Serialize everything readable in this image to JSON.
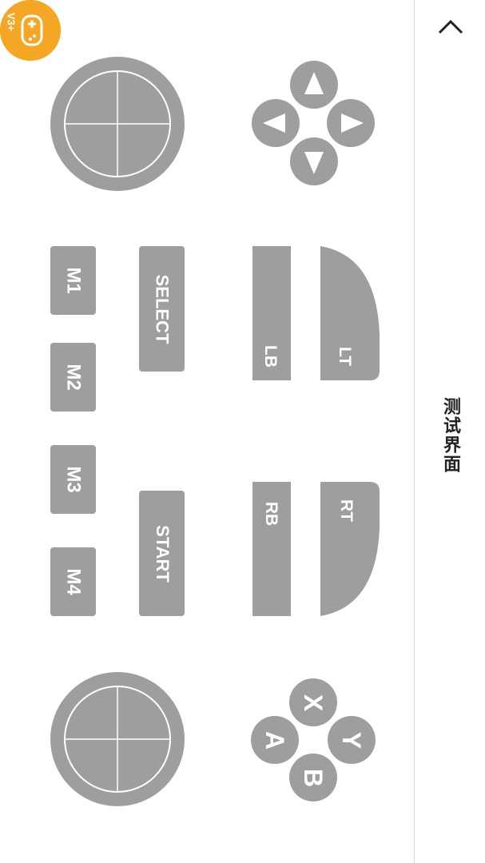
{
  "header": {
    "title": "测试界面",
    "collapse_icon": "chevron-up-icon"
  },
  "logo": {
    "text": "V3+",
    "icon": "gamepad-icon",
    "color": "#f5a623"
  },
  "colors": {
    "button": "#9e9e9e",
    "button_text": "#ffffff",
    "background": "#ffffff"
  },
  "buttons": {
    "lt": "LT",
    "lb": "LB",
    "rt": "RT",
    "rb": "RB",
    "select": "SELECT",
    "start": "START",
    "m1": "M1",
    "m2": "M2",
    "m3": "M3",
    "m4": "M4",
    "x": "X",
    "y": "Y",
    "a": "A",
    "b": "B"
  },
  "dpad": [
    "dpad-up",
    "dpad-left",
    "dpad-right",
    "dpad-down"
  ],
  "sticks": [
    "left-joystick",
    "right-joystick"
  ]
}
